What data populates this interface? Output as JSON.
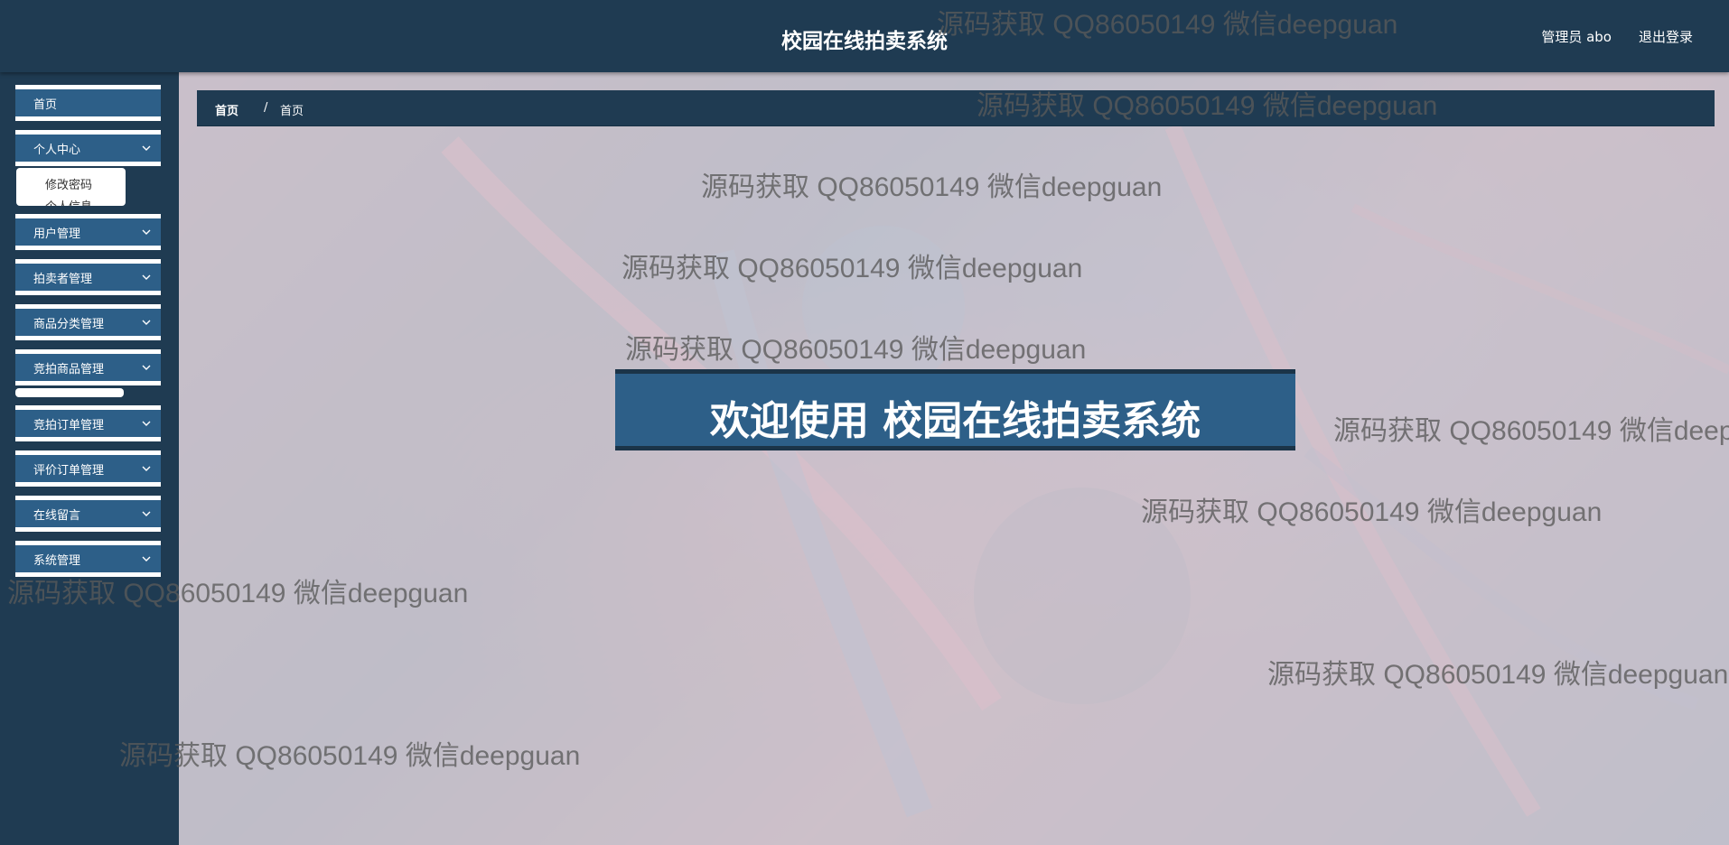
{
  "header": {
    "title": "校园在线拍卖系统",
    "admin_label": "管理员 abo",
    "logout_label": "退出登录"
  },
  "sidebar": {
    "items": [
      {
        "label": "首页"
      },
      {
        "label": "个人中心"
      },
      {
        "label": "用户管理"
      },
      {
        "label": "拍卖者管理"
      },
      {
        "label": "商品分类管理"
      },
      {
        "label": "竞拍商品管理"
      },
      {
        "label": "竞拍订单管理"
      },
      {
        "label": "评价订单管理"
      },
      {
        "label": "在线留言"
      },
      {
        "label": "系统管理"
      }
    ],
    "submenu": {
      "item1": "修改密码",
      "item2": "个人信息"
    }
  },
  "breadcrumb": {
    "home": "首页",
    "separator": "/",
    "current": "首页"
  },
  "welcome": {
    "text": "欢迎使用 校园在线拍卖系统"
  },
  "watermark": {
    "text": "源码获取 QQ86050149 微信deepguan"
  },
  "colors": {
    "header_bg": "#1f3b52",
    "menu_item_bg": "#2d5f88",
    "banner_bg": "#2d5f88"
  }
}
